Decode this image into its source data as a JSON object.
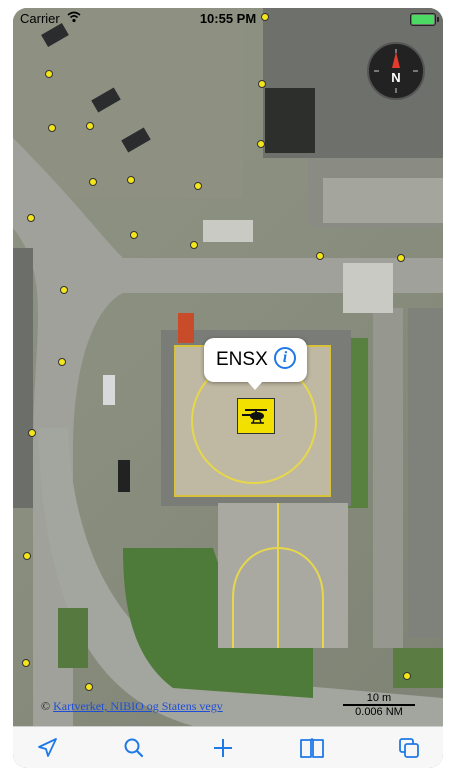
{
  "status_bar": {
    "carrier": "Carrier",
    "time": "10:55 PM"
  },
  "compass": {
    "north_label": "N"
  },
  "callout": {
    "title": "ENSX"
  },
  "scale": {
    "metric": "10 m",
    "nautical": "0.006 NM"
  },
  "attribution": {
    "prefix": "©",
    "link_text": "Kartverket, NIBIO og Statens vegv"
  },
  "toolbar": {
    "items": [
      {
        "name": "location-arrow-icon"
      },
      {
        "name": "search-icon"
      },
      {
        "name": "plus-icon"
      },
      {
        "name": "book-icon"
      },
      {
        "name": "layers-icon"
      }
    ]
  },
  "colors": {
    "accent": "#1f7ae6",
    "waypoint_dot": "#f4e61b",
    "heliport_marker": "#f2e000",
    "battery": "#4cd964"
  }
}
